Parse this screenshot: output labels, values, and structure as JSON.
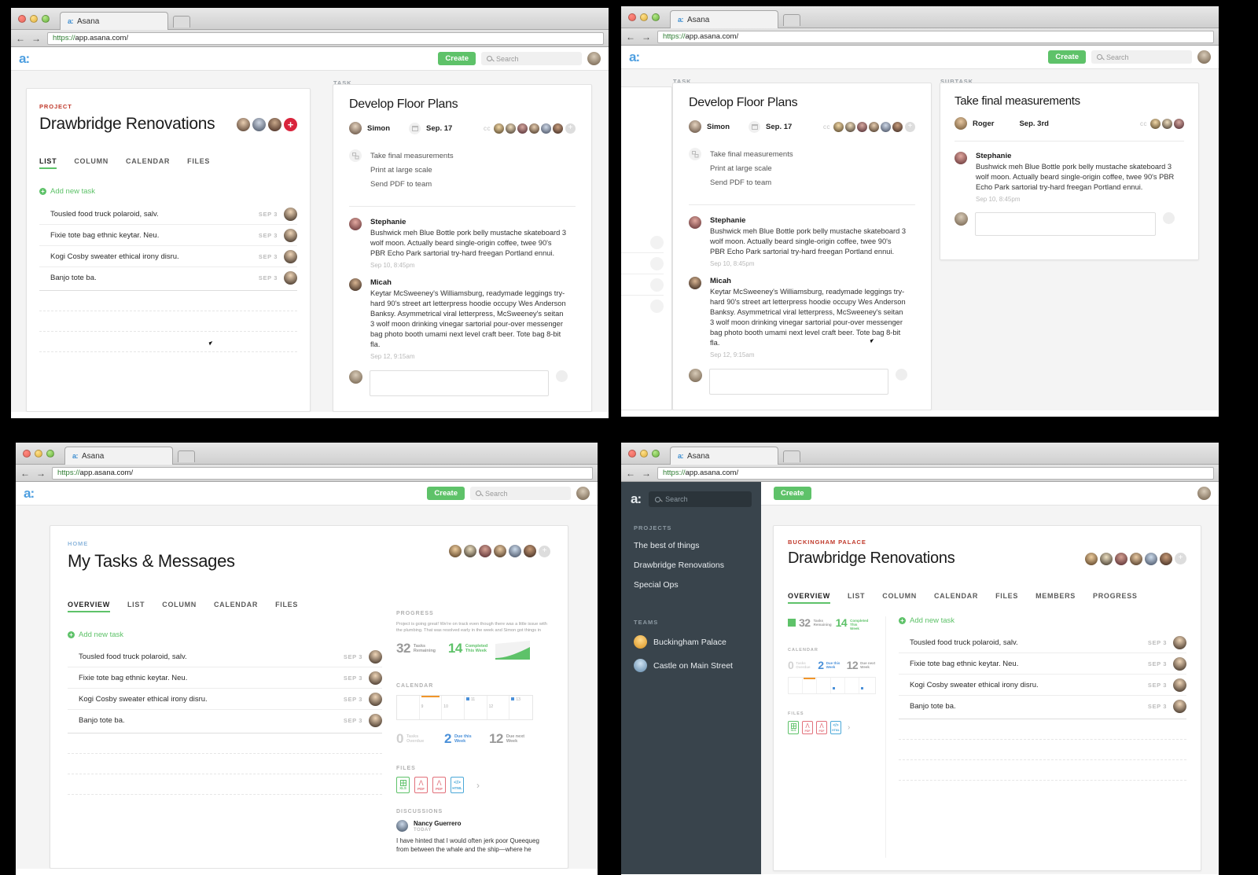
{
  "browser": {
    "tab_label": "Asana",
    "tab_favicon": "a:",
    "url_scheme": "https://",
    "url_rest": "app.asana.com/",
    "back_arrow": "←",
    "forward_arrow": "→"
  },
  "appbar": {
    "logo": "a:",
    "create_label": "Create",
    "search_placeholder": "Search"
  },
  "win1": {
    "project": {
      "eyebrow": "PROJECT",
      "title": "Drawbridge Renovations",
      "tabs": [
        "LIST",
        "COLUMN",
        "CALENDAR",
        "FILES"
      ],
      "active_tab": "LIST",
      "add_new_task": "Add new task",
      "tasks": [
        {
          "title": "Tousled food truck polaroid, salv.",
          "due": "SEP 3"
        },
        {
          "title": "Fixie tote bag ethnic keytar. Neu.",
          "due": "SEP 3"
        },
        {
          "title": "Kogi Cosby sweater ethical irony disru.",
          "due": "SEP 3"
        },
        {
          "title": "Banjo tote ba.",
          "due": "SEP 3"
        }
      ]
    },
    "task": {
      "eyebrow": "TASK",
      "title": "Develop Floor Plans",
      "assignee": "Simon",
      "due": "Sep. 17",
      "cc_label": "cc",
      "subtasks": [
        "Take final measurements",
        "Print at large scale",
        "Send PDF to team"
      ],
      "comments": [
        {
          "author": "Stephanie",
          "body": "Bushwick meh Blue Bottle pork belly mustache skateboard 3 wolf moon. Actually beard single-origin coffee, twee 90's PBR Echo Park sartorial try-hard freegan Portland ennui.",
          "ts": "Sep 10, 8:45pm"
        },
        {
          "author": "Micah",
          "body": "Keytar McSweeney's Williamsburg, readymade leggings try-hard 90's street art letterpress hoodie occupy Wes Anderson Banksy. Asymmetrical viral letterpress, McSweeney's seitan 3 wolf moon drinking vinegar sartorial pour-over messenger bag photo booth umami next level craft beer. Tote bag 8-bit fla.",
          "ts": "Sep 12, 9:15am"
        }
      ]
    }
  },
  "win2": {
    "task": {
      "eyebrow": "TASK",
      "title": "Develop Floor Plans",
      "assignee": "Simon",
      "due": "Sep. 17",
      "cc_label": "cc",
      "subtasks": [
        "Take final measurements",
        "Print at large scale",
        "Send PDF to team"
      ],
      "comments": [
        {
          "author": "Stephanie",
          "body": "Bushwick meh Blue Bottle pork belly mustache skateboard 3 wolf moon. Actually beard single-origin coffee, twee 90's PBR Echo Park sartorial try-hard freegan Portland ennui.",
          "ts": "Sep 10, 8:45pm"
        },
        {
          "author": "Micah",
          "body": "Keytar McSweeney's Williamsburg, readymade leggings try-hard 90's street art letterpress hoodie occupy Wes Anderson Banksy. Asymmetrical viral letterpress, McSweeney's seitan 3 wolf moon drinking vinegar sartorial pour-over messenger bag photo booth umami next level craft beer. Tote bag 8-bit fla.",
          "ts": "Sep 12, 9:15am"
        }
      ]
    },
    "subtask": {
      "eyebrow": "SUBTASK",
      "title": "Take final measurements",
      "assignee": "Roger",
      "due": "Sep. 3rd",
      "cc_label": "cc",
      "comments": [
        {
          "author": "Stephanie",
          "body": "Bushwick meh Blue Bottle pork belly mustache skateboard 3 wolf moon. Actually beard single-origin coffee, twee 90's PBR Echo Park sartorial try-hard freegan Portland ennui.",
          "ts": "Sep 10, 8:45pm"
        }
      ]
    }
  },
  "win3": {
    "eyebrow": "HOME",
    "title": "My Tasks & Messages",
    "tabs": [
      "OVERVIEW",
      "LIST",
      "COLUMN",
      "CALENDAR",
      "FILES"
    ],
    "active_tab": "OVERVIEW",
    "add_new_task": "Add new task",
    "tasks": [
      {
        "title": "Tousled food truck polaroid, salv.",
        "due": "SEP 3"
      },
      {
        "title": "Fixie tote bag ethnic keytar. Neu.",
        "due": "SEP 3"
      },
      {
        "title": "Kogi Cosby sweater ethical irony disru.",
        "due": "SEP 3"
      },
      {
        "title": "Banjo tote ba.",
        "due": "SEP 3"
      }
    ],
    "progress": {
      "label": "PROGRESS",
      "note": "Project is going great! We're on track even though there was a little issue with the plumbing.  That was resolved early in the week and Simon got things in",
      "remaining_value": "32",
      "remaining_label": "Tasks Remaining",
      "completed_value": "14",
      "completed_label": "Completed This Week"
    },
    "calendar": {
      "label": "CALENDAR",
      "days": [
        "9",
        "10",
        "11",
        "12",
        "13"
      ],
      "overdue_value": "0",
      "overdue_label": "Tasks Overdue",
      "due_this_week_value": "2",
      "due_this_week_label": "Due this Week",
      "due_next_week_value": "12",
      "due_next_week_label": "Due next Week"
    },
    "files": {
      "label": "FILES",
      "items": [
        {
          "ext": "XLS",
          "color": "#5ec269"
        },
        {
          "ext": "PDF",
          "color": "#e2707a"
        },
        {
          "ext": "PDF",
          "color": "#e2707a"
        },
        {
          "ext": "HTML",
          "color": "#4aa8d8"
        }
      ],
      "more_arrow": "›"
    },
    "discussions": {
      "label": "DISCUSSIONS",
      "author": "Nancy Guerrero",
      "ts": "TODAY",
      "body": "I have hinted that I would often jerk poor Queequeg from between the whale and the ship—where he"
    }
  },
  "win4": {
    "sidebar": {
      "logo": "a:",
      "search_placeholder": "Search",
      "projects_label": "PROJECTS",
      "projects": [
        "The best of things",
        "Drawbridge Renovations",
        "Special Ops"
      ],
      "teams_label": "TEAMS",
      "teams": [
        {
          "name": "Buckingham Palace",
          "color": "#f0a830"
        },
        {
          "name": "Castle on Main Street",
          "color": "#6ba3cc"
        }
      ]
    },
    "create_label": "Create",
    "eyebrow": "BUCKINGHAM PALACE",
    "title": "Drawbridge Renovations",
    "tabs": [
      "OVERVIEW",
      "LIST",
      "COLUMN",
      "CALENDAR",
      "FILES",
      "MEMBERS",
      "PROGRESS"
    ],
    "active_tab": "OVERVIEW",
    "add_new_task": "Add new task",
    "tasks": [
      {
        "title": "Tousled food truck polaroid, salv.",
        "due": "SEP 3"
      },
      {
        "title": "Fixie tote bag ethnic keytar. Neu.",
        "due": "SEP 3"
      },
      {
        "title": "Kogi Cosby sweater ethical irony disru.",
        "due": "SEP 3"
      },
      {
        "title": "Banjo tote ba.",
        "due": "SEP 3"
      }
    ],
    "stats": {
      "remaining_value": "32",
      "remaining_label": "Tasks Remaining",
      "completed_value": "14",
      "completed_label": "Completed This Week"
    },
    "calendar": {
      "label": "CALENDAR",
      "overdue_value": "0",
      "overdue_label": "Tasks Overdue",
      "due_this_week_value": "2",
      "due_this_week_label": "Due this Week",
      "due_next_week_value": "12",
      "due_next_week_label": "Due next Week"
    },
    "files": {
      "label": "FILES",
      "items": [
        {
          "ext": "XLS",
          "color": "#5ec269"
        },
        {
          "ext": "PDF",
          "color": "#e2707a"
        },
        {
          "ext": "PDF",
          "color": "#e2707a"
        },
        {
          "ext": "HTML",
          "color": "#4aa8d8"
        }
      ],
      "more_arrow": "›"
    }
  },
  "colors": {
    "accent_green": "#5ec269",
    "accent_red": "#c0392b",
    "logo_blue": "#4e9fe0",
    "sidebar_dark": "#39444c"
  }
}
